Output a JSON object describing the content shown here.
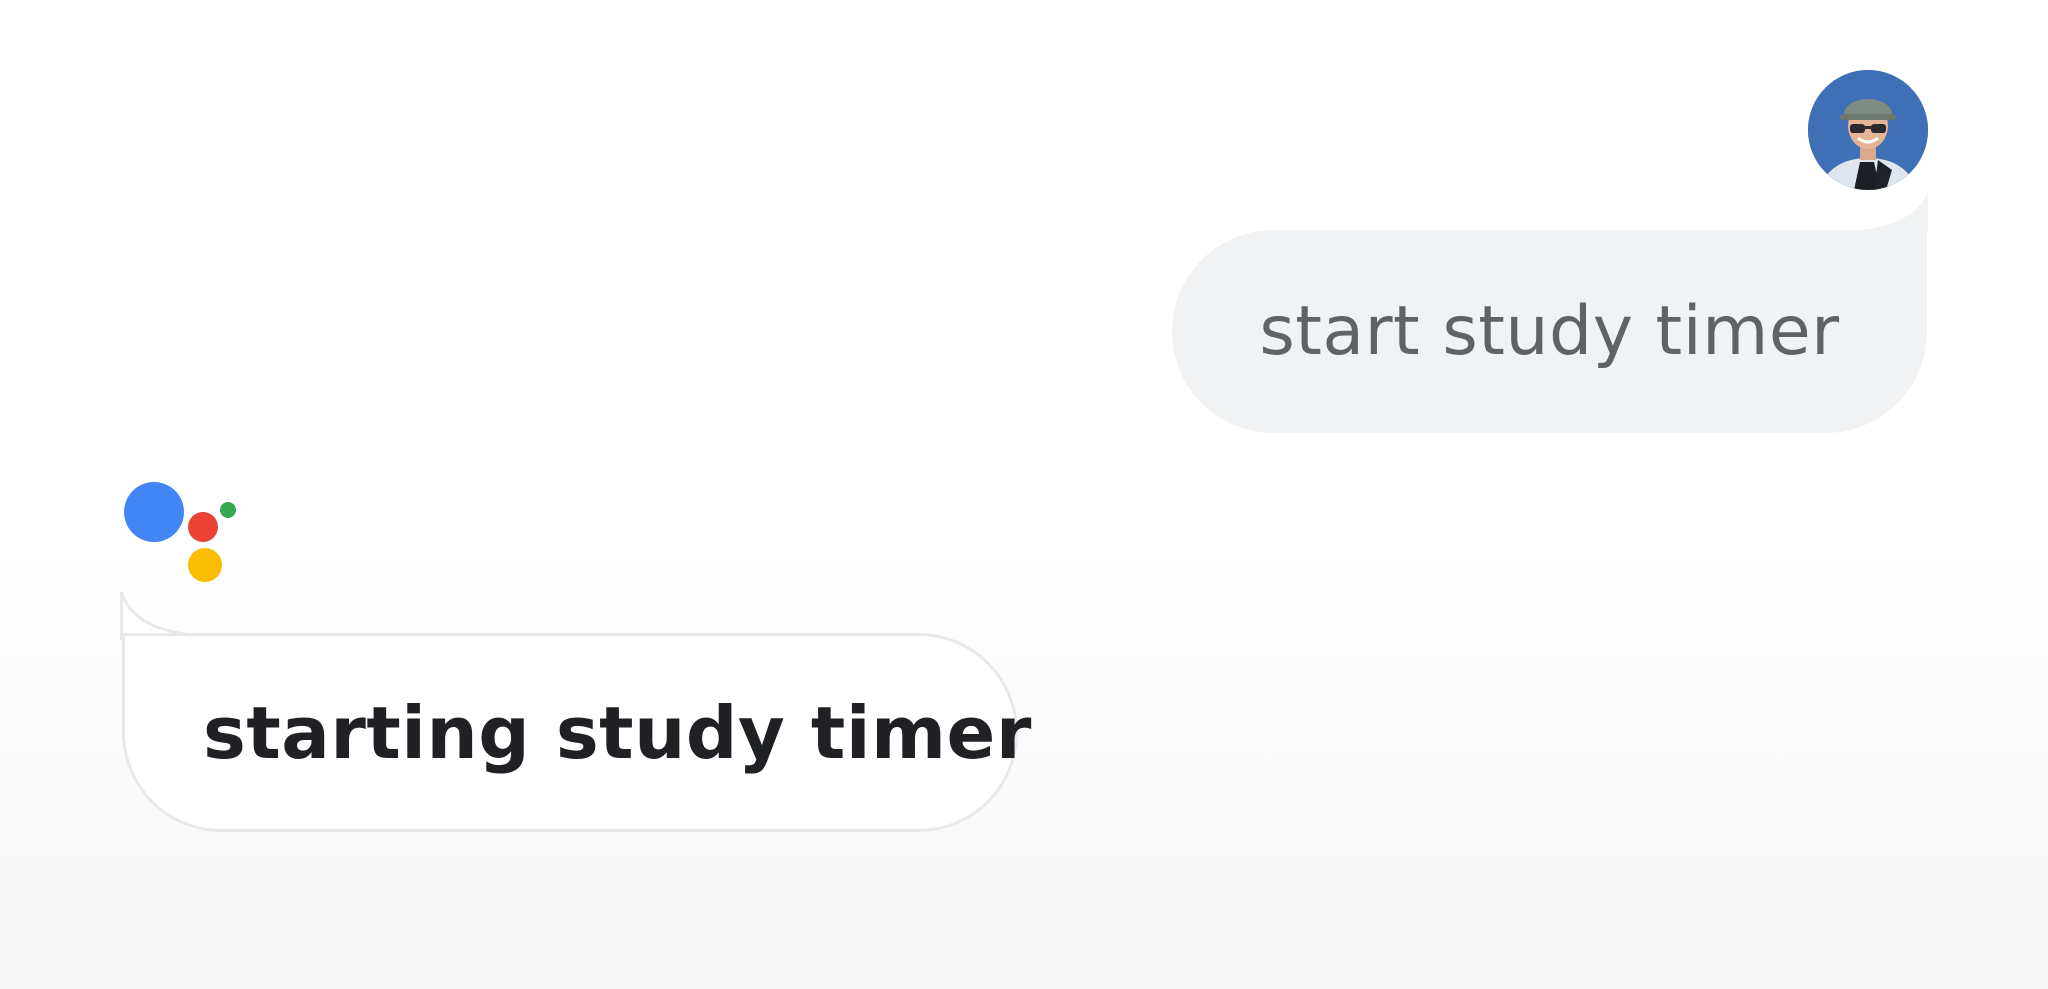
{
  "conversation": {
    "user": {
      "avatar_icon": "user-avatar-photo",
      "message": "start study timer"
    },
    "assistant": {
      "logo_icon": "google-assistant-logo",
      "logo_colors": [
        "#4285f4",
        "#ea4335",
        "#34a853",
        "#fbbc04"
      ],
      "message": "starting study timer"
    }
  },
  "colors": {
    "user_bubble": "#f1f2f4",
    "user_text": "#5f6368",
    "assistant_bubble_border": "#e8e9eb",
    "assistant_text": "#202124"
  }
}
